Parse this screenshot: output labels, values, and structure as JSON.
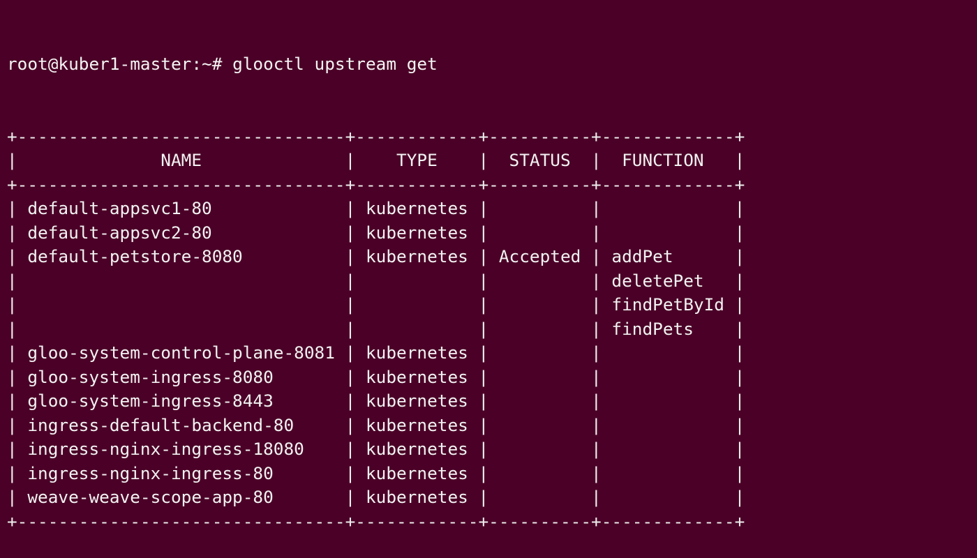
{
  "terminal": {
    "prompt": "root@kuber1-master:~#",
    "command": "glooctl upstream get",
    "columns": [
      "NAME",
      "TYPE",
      "STATUS",
      "FUNCTION"
    ],
    "rows": [
      {
        "name": "default-appsvc1-80",
        "type": "kubernetes",
        "status": "",
        "function": ""
      },
      {
        "name": "default-appsvc2-80",
        "type": "kubernetes",
        "status": "",
        "function": ""
      },
      {
        "name": "default-petstore-8080",
        "type": "kubernetes",
        "status": "Accepted",
        "function": "addPet"
      },
      {
        "name": "",
        "type": "",
        "status": "",
        "function": "deletePet"
      },
      {
        "name": "",
        "type": "",
        "status": "",
        "function": "findPetById"
      },
      {
        "name": "",
        "type": "",
        "status": "",
        "function": "findPets"
      },
      {
        "name": "gloo-system-control-plane-8081",
        "type": "kubernetes",
        "status": "",
        "function": ""
      },
      {
        "name": "gloo-system-ingress-8080",
        "type": "kubernetes",
        "status": "",
        "function": ""
      },
      {
        "name": "gloo-system-ingress-8443",
        "type": "kubernetes",
        "status": "",
        "function": ""
      },
      {
        "name": "ingress-default-backend-80",
        "type": "kubernetes",
        "status": "",
        "function": ""
      },
      {
        "name": "ingress-nginx-ingress-18080",
        "type": "kubernetes",
        "status": "",
        "function": ""
      },
      {
        "name": "ingress-nginx-ingress-80",
        "type": "kubernetes",
        "status": "",
        "function": ""
      },
      {
        "name": "weave-weave-scope-app-80",
        "type": "kubernetes",
        "status": "",
        "function": ""
      }
    ],
    "colors": {
      "background": "#4b0127",
      "text": "#f2f2f2"
    }
  }
}
